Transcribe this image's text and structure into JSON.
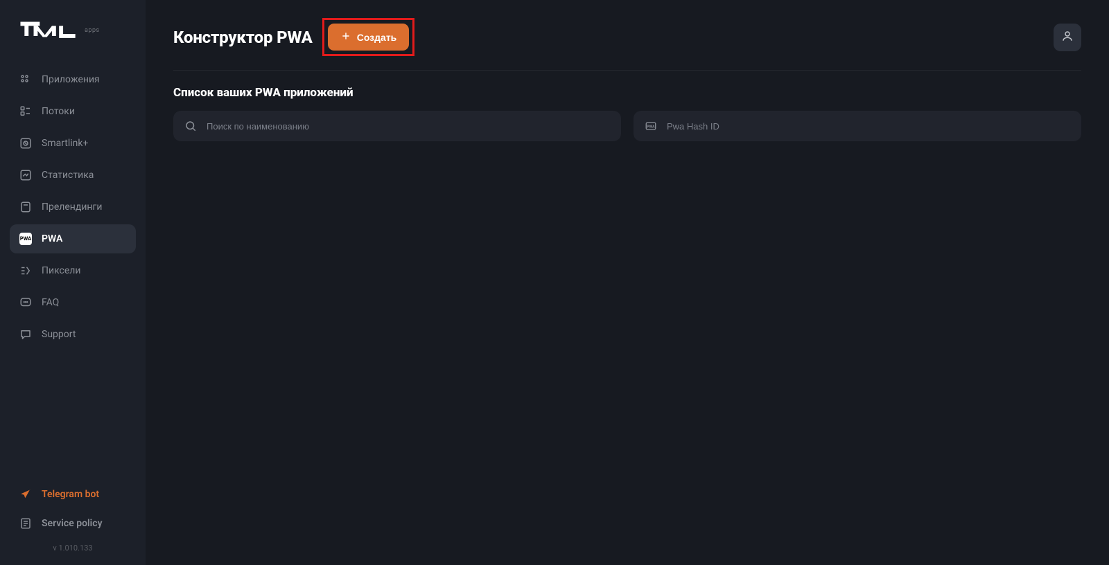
{
  "brand": {
    "apps_label": "apps"
  },
  "sidebar": {
    "items": [
      {
        "key": "apps",
        "label": "Приложения"
      },
      {
        "key": "streams",
        "label": "Потоки"
      },
      {
        "key": "smartlink",
        "label": "Smartlink+"
      },
      {
        "key": "stats",
        "label": "Статистика"
      },
      {
        "key": "prelanding",
        "label": "Прелендинги"
      },
      {
        "key": "pwa",
        "label": "PWA"
      },
      {
        "key": "pixels",
        "label": "Пиксели"
      },
      {
        "key": "faq",
        "label": "FAQ"
      },
      {
        "key": "support",
        "label": "Support"
      }
    ],
    "bottom": [
      {
        "key": "tgbot",
        "label": "Telegram bot"
      },
      {
        "key": "policy",
        "label": "Service policy"
      }
    ],
    "version": "v 1.010.133"
  },
  "header": {
    "title": "Конструктор PWA",
    "create_label": "Создать"
  },
  "list": {
    "heading": "Список ваших PWA приложений",
    "search_placeholder": "Поиск по наименованию",
    "hash_placeholder": "Pwa Hash ID"
  },
  "icons": {
    "pwa_badge": "PWA"
  }
}
